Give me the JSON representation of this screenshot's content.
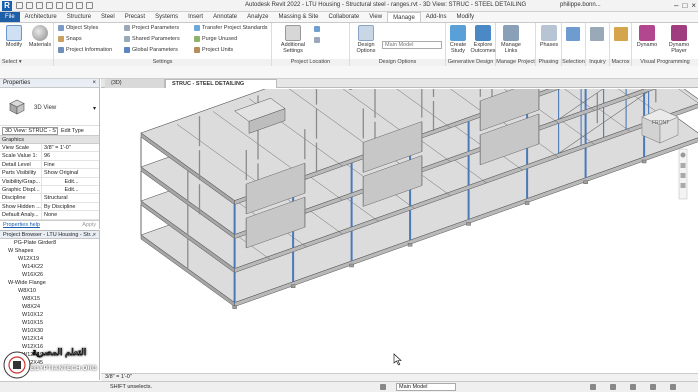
{
  "app": {
    "title": "Autodesk Revit 2022 - LTU Housing - Structural steel - ranges.rvt - 3D View: STRUC - STEEL DETAILING",
    "user": "philippe.bonn..."
  },
  "tabs": [
    "File",
    "Architecture",
    "Structure",
    "Steel",
    "Precast",
    "Systems",
    "Insert",
    "Annotate",
    "Analyze",
    "Massing & Site",
    "Collaborate",
    "View",
    "Manage",
    "Add-Ins",
    "Modify"
  ],
  "active_tab": "Manage",
  "ribbon": {
    "modify_label": "Modify",
    "materials_label": "Materials",
    "select_label": "Select ▾",
    "settings_small": [
      "Object Styles",
      "Project Parameters",
      "Transfer Project Standards",
      "Snaps",
      "Shared Parameters",
      "Purge Unused",
      "Project Information",
      "Global Parameters",
      "Project Units"
    ],
    "settings_panel": "Settings",
    "additional_settings": "Additional Settings",
    "project_location_panel": "Project Location",
    "design_options_label": "Design Options",
    "main_model": "Main Model",
    "design_options_panel": "Design Options",
    "create_study": "Create Study",
    "explore_outcomes": "Explore Outcomes",
    "generative_panel": "Generative Design",
    "manage_links": "Manage Links",
    "manage_project_panel": "Manage Project",
    "phases": "Phases",
    "phasing_panel": "Phasing",
    "selection_panel": "Selection",
    "inquiry_panel": "Inquiry",
    "macros_panel": "Macros",
    "dynamo": "Dynamo",
    "dynamo_player": "Dynamo Player",
    "visual_programming_panel": "Visual Programming"
  },
  "properties": {
    "header": "Properties",
    "type_name": "3D View",
    "selector": "3D View: STRUC - STE",
    "edit_type": "Edit Type",
    "group": "Graphics",
    "rows": [
      {
        "k": "View Scale",
        "v": "3/8\" = 1'-0\""
      },
      {
        "k": "Scale Value 1:",
        "v": "96"
      },
      {
        "k": "Detail Level",
        "v": "Fine"
      },
      {
        "k": "Parts Visibility",
        "v": "Show Original"
      },
      {
        "k": "Visibility/Grap...",
        "v": "Edit..."
      },
      {
        "k": "Graphic Displ...",
        "v": "Edit..."
      },
      {
        "k": "Discipline",
        "v": "Structural"
      },
      {
        "k": "Show Hidden ...",
        "v": "By Discipline"
      },
      {
        "k": "Default Analy...",
        "v": "None"
      }
    ],
    "help_link": "Properties help",
    "apply": "Apply"
  },
  "browser": {
    "header": "Project Browser - LTU Housing - Str...",
    "items": [
      "PG-Plate Girder8",
      "W Shapes",
      "W12X19",
      "W14X22",
      "W16X26",
      "W-Wide Flange",
      "W8X10",
      "W8X15",
      "W8X24",
      "W10X12",
      "W10X15",
      "W10X30",
      "W12X14",
      "W12X16",
      "W12X19",
      "W12X45"
    ]
  },
  "view_tabs": {
    "inactive": "{3D}",
    "active": "STRUC - STEEL DETAILING"
  },
  "viewcube": {
    "label": "FRONT"
  },
  "view_control": "3/8\" = 1'-0\"",
  "status": {
    "message": "SHIFT unselects.",
    "model": "Main Model"
  },
  "watermark": {
    "arabic": "التعلم المصرية",
    "english": "EGYPTIANTECH.ORG"
  },
  "colors": {
    "file_tab": "#1f5fa8",
    "steel_column": "#4a79b8",
    "slab": "#d6d6d6"
  }
}
